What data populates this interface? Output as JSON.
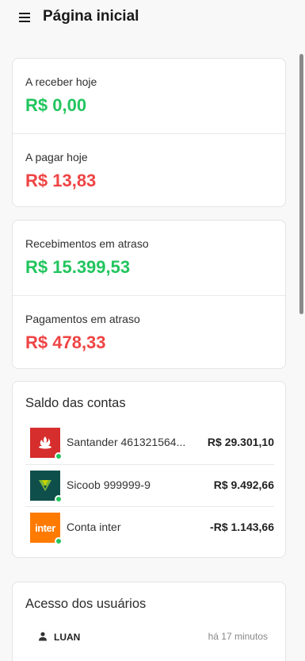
{
  "header": {
    "title": "Página inicial",
    "menu_icon": "menu-icon"
  },
  "summary_today": {
    "receivable": {
      "label": "A receber hoje",
      "value": "R$ 0,00",
      "color": "#22c55e"
    },
    "payable": {
      "label": "A pagar hoje",
      "value": "R$ 13,83",
      "color": "#ef4444"
    }
  },
  "summary_overdue": {
    "receivable": {
      "label": "Recebimentos em atraso",
      "value": "R$ 15.399,53",
      "color": "#22c55e"
    },
    "payable": {
      "label": "Pagamentos em atraso",
      "value": "R$ 478,33",
      "color": "#ef4444"
    }
  },
  "accounts": {
    "title": "Saldo das contas",
    "items": [
      {
        "name": "Santander 461321564...",
        "balance": "R$ 29.301,10",
        "logo": "santander-logo",
        "status": "online"
      },
      {
        "name": "Sicoob 999999-9",
        "balance": "R$ 9.492,66",
        "logo": "sicoob-logo",
        "status": "online"
      },
      {
        "name": "Conta inter",
        "balance": "-R$ 1.143,66",
        "logo": "inter-logo",
        "logo_text": "inter",
        "status": "online"
      }
    ]
  },
  "user_access": {
    "title": "Acesso dos usuários",
    "items": [
      {
        "name": "LUAN",
        "time": "há 17 minutos",
        "icon": "user-icon"
      }
    ]
  }
}
